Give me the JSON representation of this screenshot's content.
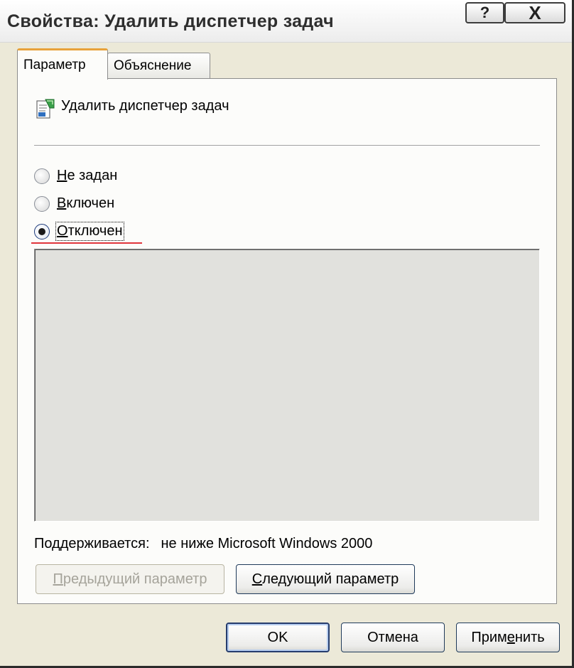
{
  "window": {
    "title": "Свойства: Удалить диспетчер задач",
    "help_button": "?",
    "close_button": "X"
  },
  "tabs": [
    {
      "label": "Параметр",
      "active": true
    },
    {
      "label": "Объяснение",
      "active": false
    }
  ],
  "policy": {
    "icon": "policy-setting-icon",
    "name": "Удалить диспетчер задач"
  },
  "options": [
    {
      "first": "Н",
      "rest": "е задан",
      "selected": false
    },
    {
      "first": "В",
      "rest": "ключен",
      "selected": false
    },
    {
      "first": "О",
      "rest": "тключен",
      "selected": true
    }
  ],
  "supported": {
    "label": "Поддерживается:",
    "value": "не ниже Microsoft Windows 2000"
  },
  "nav_buttons": {
    "prev": {
      "underlined": "П",
      "rest": "редыдущий параметр",
      "enabled": false
    },
    "next": {
      "underlined": "С",
      "rest": "ледующий параметр",
      "enabled": true
    }
  },
  "dialog_buttons": {
    "ok": "OK",
    "cancel": "Отмена",
    "apply_before": "Прим",
    "apply_underlined": "е",
    "apply_after": "нить"
  },
  "colors": {
    "dialog_bg": "#ece9d8",
    "panel_bg": "#fcfcfa",
    "tab_accent": "#e8a23a",
    "annotation_red": "#e0343b"
  }
}
